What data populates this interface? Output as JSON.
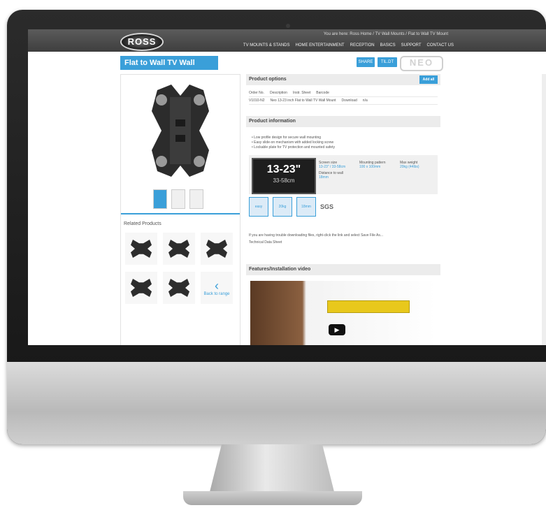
{
  "site": {
    "logo_text": "ROSS",
    "top_text": "You are here: Ross Home / TV Wall Mounts / Flat to Wall TV Mount",
    "nav": [
      "TV MOUNTS & STANDS",
      "HOME ENTERTAINMENT",
      "RECEPTION",
      "BASICS",
      "SUPPORT",
      "CONTACT US"
    ]
  },
  "page": {
    "title": "Flat to Wall TV Wall Mount",
    "btn_share": "SHARE",
    "btn_tilt": "TIL.DT",
    "brand_badge": "NEO"
  },
  "left": {
    "related_title": "Related Products",
    "back_label": "Back to range"
  },
  "product_options": {
    "heading": "Product options",
    "add_label": "Add all",
    "columns": [
      "Order No.",
      "Description",
      "Instr. Sheet",
      "Barcode"
    ],
    "row": [
      "V1010-N2",
      "Neo 13-23 inch Flat to Wall TV Wall Mount",
      "Download",
      "n/a"
    ]
  },
  "product_info": {
    "heading": "Product information",
    "bullets": [
      "Low profile design for secure wall mounting",
      "Easy slide-on mechanism with added locking screw",
      "Lockable plate for TV protection and mounted safety"
    ],
    "size_big": "13-23\"",
    "size_small": "33-58cm",
    "specs": [
      {
        "k": "Screen size",
        "v": "13-23\" / 33-58cm"
      },
      {
        "k": "Mounting pattern",
        "v": "100 x 100mm"
      },
      {
        "k": "Max weight",
        "v": "20kg (44lbs)"
      },
      {
        "k": "Distance to wall",
        "v": "18mm"
      }
    ],
    "icon_labels": [
      "easy",
      "20kg",
      "18mm",
      "SGS"
    ],
    "sgs_label": "SGS",
    "note": "If you are having trouble downloading files, right-click the link and select Save File As...",
    "link_label": "Technical Data Sheet"
  },
  "video": {
    "heading": "Features/Installation video",
    "play_label": "▶"
  },
  "colors": {
    "accent": "#3a9fd9",
    "topbar": "#4a4a4a",
    "level": "#e8c81c"
  }
}
